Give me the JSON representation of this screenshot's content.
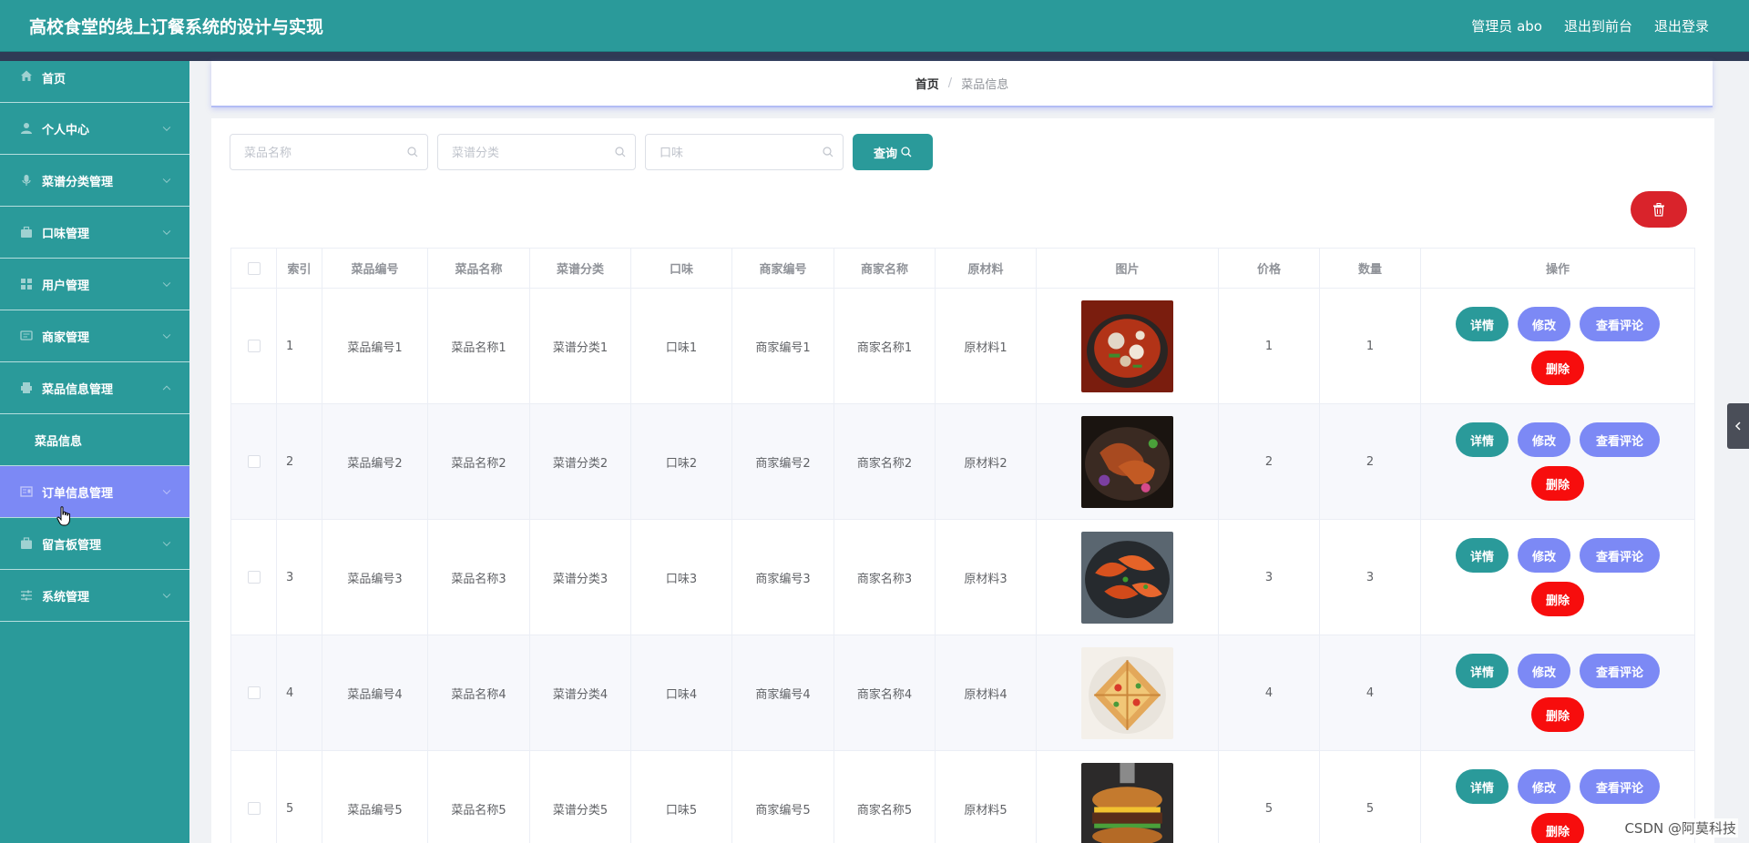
{
  "header": {
    "title": "高校食堂的线上订餐系统的设计与实现",
    "admin": "管理员 abo",
    "back_front": "退出到前台",
    "logout": "退出登录"
  },
  "sidebar": {
    "items": [
      {
        "label": "首页",
        "icon": "home-icon"
      },
      {
        "label": "个人中心",
        "icon": "user-icon"
      },
      {
        "label": "菜谱分类管理",
        "icon": "microphone-icon"
      },
      {
        "label": "口味管理",
        "icon": "briefcase-icon"
      },
      {
        "label": "用户管理",
        "icon": "grid-icon"
      },
      {
        "label": "商家管理",
        "icon": "message-icon"
      },
      {
        "label": "菜品信息管理",
        "icon": "printer-icon"
      },
      {
        "label": "菜品信息",
        "icon": ""
      },
      {
        "label": "订单信息管理",
        "icon": "document-icon"
      },
      {
        "label": "留言板管理",
        "icon": "suitcase-icon"
      },
      {
        "label": "系统管理",
        "icon": "sliders-icon"
      }
    ]
  },
  "breadcrumb": {
    "home": "首页",
    "separator": "/",
    "current": "菜品信息"
  },
  "search": {
    "name_placeholder": "菜品名称",
    "category_placeholder": "菜谱分类",
    "taste_placeholder": "口味",
    "query_label": "查询"
  },
  "table": {
    "headers": [
      "索引",
      "菜品编号",
      "菜品名称",
      "菜谱分类",
      "口味",
      "商家编号",
      "商家名称",
      "原材料",
      "图片",
      "价格",
      "数量",
      "操作"
    ],
    "rows": [
      {
        "index": "1",
        "code": "菜品编号1",
        "name": "菜品名称1",
        "category": "菜谱分类1",
        "taste": "口味1",
        "shop_code": "商家编号1",
        "shop_name": "商家名称1",
        "material": "原材料1",
        "price": "1",
        "qty": "1"
      },
      {
        "index": "2",
        "code": "菜品编号2",
        "name": "菜品名称2",
        "category": "菜谱分类2",
        "taste": "口味2",
        "shop_code": "商家编号2",
        "shop_name": "商家名称2",
        "material": "原材料2",
        "price": "2",
        "qty": "2"
      },
      {
        "index": "3",
        "code": "菜品编号3",
        "name": "菜品名称3",
        "category": "菜谱分类3",
        "taste": "口味3",
        "shop_code": "商家编号3",
        "shop_name": "商家名称3",
        "material": "原材料3",
        "price": "3",
        "qty": "3"
      },
      {
        "index": "4",
        "code": "菜品编号4",
        "name": "菜品名称4",
        "category": "菜谱分类4",
        "taste": "口味4",
        "shop_code": "商家编号4",
        "shop_name": "商家名称4",
        "material": "原材料4",
        "price": "4",
        "qty": "4"
      },
      {
        "index": "5",
        "code": "菜品编号5",
        "name": "菜品名称5",
        "category": "菜谱分类5",
        "taste": "口味5",
        "shop_code": "商家编号5",
        "shop_name": "商家名称5",
        "material": "原材料5",
        "price": "5",
        "qty": "5"
      }
    ],
    "actions": {
      "detail": "详情",
      "edit": "修改",
      "review": "查看评论",
      "delete": "删除"
    }
  },
  "watermark": "CSDN @阿莫科技"
}
